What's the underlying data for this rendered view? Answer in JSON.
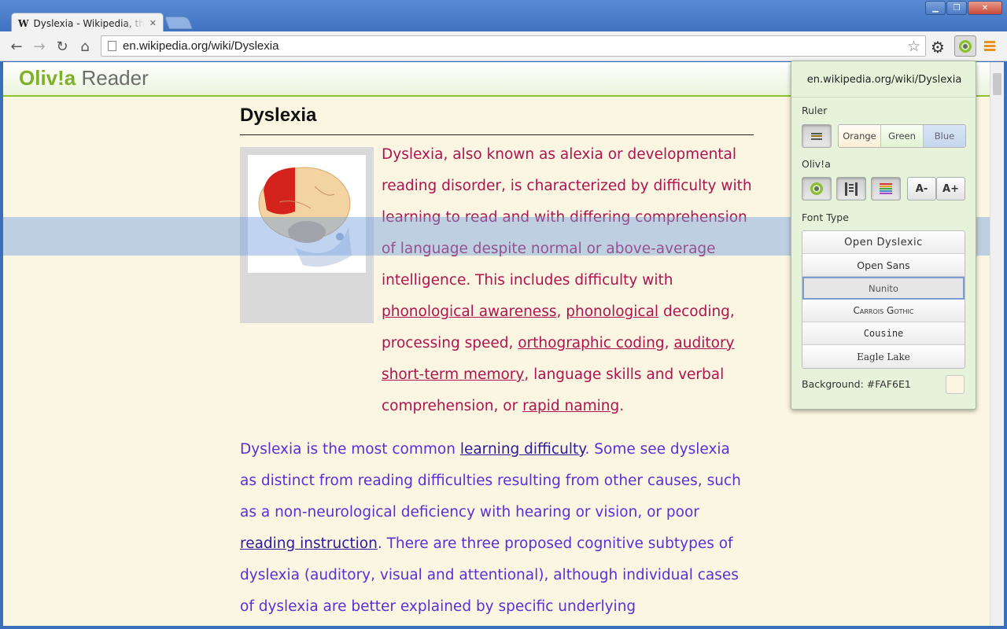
{
  "browser": {
    "tab_title": "Dyslexia - Wikipedia, the free encyclopedia",
    "tab_icon": "W",
    "url": "en.wikipedia.org/wiki/Dyslexia"
  },
  "reader": {
    "logo_main": "Oliv!a",
    "logo_sub": "Reader"
  },
  "article": {
    "title": "Dyslexia",
    "p1": [
      [
        "Dyslexia, also known as alexia or developmental"
      ],
      [
        "reading disorder, is characterized by difficulty with"
      ],
      [
        "learning to read and with differing comprehension"
      ],
      [
        "of language despite normal or above-average"
      ],
      [
        "intelligence. This includes difficulty with"
      ],
      [
        "phonological awareness",
        ", ",
        "phonological",
        " decoding,"
      ],
      [
        "processing speed, ",
        "orthographic coding",
        ", ",
        "auditory"
      ],
      [
        "short-term memory",
        ", language skills and verbal"
      ],
      [
        "comprehension, or ",
        "rapid naming",
        "."
      ]
    ],
    "p2": [
      [
        "Dyslexia is the most common ",
        "learning difficulty",
        ". Some see dyslexia"
      ],
      [
        "as distinct from reading difficulties resulting from other causes, such"
      ],
      [
        "as a non-neurological deficiency with hearing or vision, or poor"
      ],
      [
        "reading instruction",
        ". There are three proposed cognitive subtypes of"
      ],
      [
        "dyslexia (auditory, visual and attentional), although individual cases"
      ],
      [
        "of dyslexia are better explained by specific underlying"
      ]
    ],
    "links": [
      "phonological awareness",
      "phonological",
      "orthographic coding",
      "auditory",
      "short-term memory",
      "rapid naming",
      "learning difficulty",
      "reading instruction"
    ]
  },
  "popup": {
    "url": "en.wikipedia.org/wiki/Dyslexia",
    "ruler_label": "Ruler",
    "ruler_options": [
      "Orange",
      "Green",
      "Blue"
    ],
    "ruler_selected": "Blue",
    "olivia_label": "Oliv!a",
    "font_decrease": "A-",
    "font_increase": "A+",
    "font_type_label": "Font Type",
    "fonts": [
      "Open Dyslexic",
      "Open Sans",
      "Nunito",
      "Carrois Gothic",
      "Cousine",
      "Eagle Lake"
    ],
    "font_selected": "Nunito",
    "background_text": "Background: #FAF6E1",
    "background_color": "#FAF6E1"
  },
  "colors": {
    "accent": "#8dbf2f",
    "ruler": "#73a0e1",
    "p1_text": "#b0134f",
    "p2_text": "#5c2fd6"
  }
}
